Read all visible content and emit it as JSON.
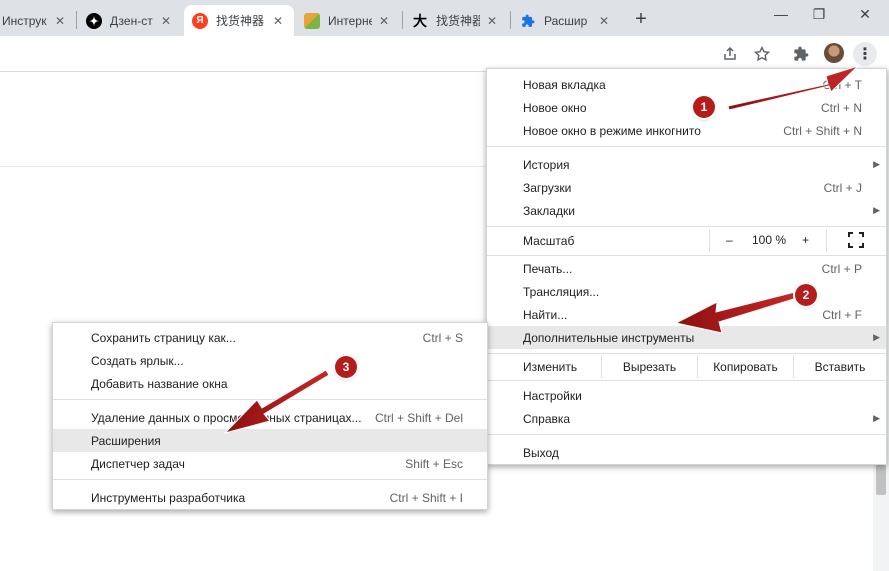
{
  "tabs": [
    {
      "title": "Инструк",
      "icon": "chrome-tab-icon",
      "active": false
    },
    {
      "title": "Дзен-ст",
      "icon": "dzen-logo-icon",
      "active": false
    },
    {
      "title": "找货神器",
      "icon": "yandex-logo-icon",
      "active": true
    },
    {
      "title": "Интерне",
      "icon": "site-favicon-icon",
      "active": false
    },
    {
      "title": "找货神器",
      "icon": "da-favicon-icon",
      "active": false
    },
    {
      "title": "Расшир",
      "icon": "extensions-puzzle-icon",
      "active": false
    }
  ],
  "tab_close_glyph": "✕",
  "new_tab_glyph": "+",
  "yandex_glyph": "Я",
  "da_glyph": "大",
  "window_controls": {
    "minimize": "—",
    "maximize": "❐",
    "close": "✕"
  },
  "menu": {
    "new_tab": {
      "label": "Новая вкладка",
      "shortcut": "Ctrl + T"
    },
    "new_window": {
      "label": "Новое окно",
      "shortcut": "Ctrl + N"
    },
    "incognito": {
      "label": "Новое окно в режиме инкогнито",
      "shortcut": "Ctrl + Shift + N"
    },
    "history": {
      "label": "История"
    },
    "downloads": {
      "label": "Загрузки",
      "shortcut": "Ctrl + J"
    },
    "bookmarks": {
      "label": "Закладки"
    },
    "zoom": {
      "label": "Масштаб",
      "minus": "–",
      "value": "100 %",
      "plus": "+"
    },
    "print": {
      "label": "Печать...",
      "shortcut": "Ctrl + P"
    },
    "cast": {
      "label": "Трансляция..."
    },
    "find": {
      "label": "Найти...",
      "shortcut": "Ctrl + F"
    },
    "more_tools": {
      "label": "Дополнительные инструменты"
    },
    "edit": {
      "label": "Изменить",
      "cut": "Вырезать",
      "copy": "Копировать",
      "paste": "Вставить"
    },
    "settings": {
      "label": "Настройки"
    },
    "help": {
      "label": "Справка"
    },
    "exit": {
      "label": "Выход"
    }
  },
  "submenu": {
    "save_page": {
      "label": "Сохранить страницу как...",
      "shortcut": "Ctrl + S"
    },
    "create_shortcut": {
      "label": "Создать ярлык..."
    },
    "name_window": {
      "label": "Добавить название окна"
    },
    "clear_data": {
      "label": "Удаление данных о просмотренных страницах...",
      "shortcut": "Ctrl + Shift + Del"
    },
    "extensions": {
      "label": "Расширения"
    },
    "task_manager": {
      "label": "Диспетчер задач",
      "shortcut": "Shift + Esc"
    },
    "dev_tools": {
      "label": "Инструменты разработчика",
      "shortcut": "Ctrl + Shift + I"
    }
  },
  "annotations": [
    "1",
    "2",
    "3"
  ],
  "colors": {
    "annotation_red": "#b51d1d",
    "hover_gray": "#e8e8e8",
    "tabstrip": "#dee1e6"
  }
}
